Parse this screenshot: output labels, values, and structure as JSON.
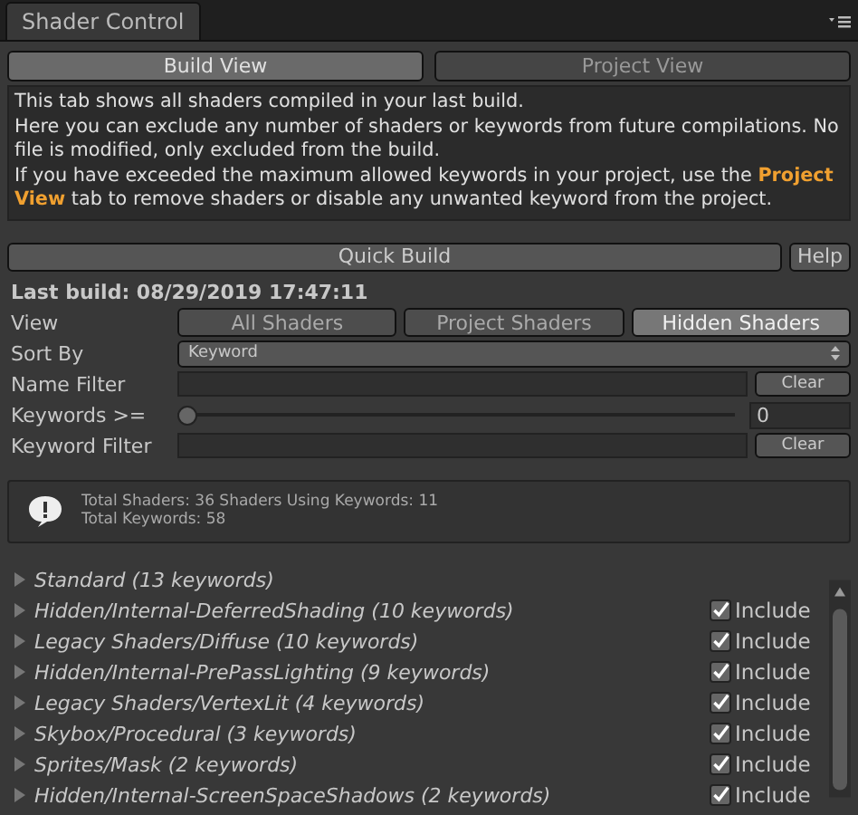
{
  "window": {
    "tab": "Shader Control"
  },
  "view_tabs": [
    {
      "label": "Build View",
      "selected": true
    },
    {
      "label": "Project View",
      "selected": false
    }
  ],
  "description": [
    "This tab shows all shaders compiled in your last build.",
    "Here you can exclude any number of shaders or keywords from future compilations. No file is modified, only excluded from the build.",
    "If you have exceeded the maximum allowed keywords in your project, use the **Project View** tab to remove shaders or disable any unwanted keyword from the project."
  ],
  "quick_build": "Quick Build",
  "help": "Help",
  "last_build": "Last build: 08/29/2019 17:47:11",
  "view": {
    "label": "View",
    "options": [
      {
        "label": "All Shaders",
        "selected": false
      },
      {
        "label": "Project Shaders",
        "selected": false
      },
      {
        "label": "Hidden Shaders",
        "selected": true
      }
    ]
  },
  "sort_by": {
    "label": "Sort By",
    "value": "Keyword"
  },
  "name_filter": {
    "label": "Name Filter",
    "clear": "Clear"
  },
  "keywords_min": {
    "label": "Keywords >=",
    "level": 0,
    "value": "0"
  },
  "keyword_filter": {
    "label": "Keyword Filter",
    "clear": "Clear"
  },
  "info": [
    "Total Shaders: 36  Shaders Using Keywords: 11",
    "Total Keywords: 58"
  ],
  "shaders": [
    {
      "name": "Standard (13 keywords)",
      "expanded": false
    },
    {
      "name": "Hidden/Internal-DeferredShading (10 keywords)",
      "expanded": false,
      "include": {
        "label": "Include",
        "checked": true
      }
    },
    {
      "name": "Legacy Shaders/Diffuse (10 keywords)",
      "expanded": false,
      "include": {
        "label": "Include",
        "checked": true
      }
    },
    {
      "name": "Hidden/Internal-PrePassLighting (9 keywords)",
      "expanded": false,
      "include": {
        "label": "Include",
        "checked": true
      }
    },
    {
      "name": "Legacy Shaders/VertexLit (4 keywords)",
      "expanded": false,
      "include": {
        "label": "Include",
        "checked": true
      }
    },
    {
      "name": "Skybox/Procedural (3 keywords)",
      "expanded": false,
      "include": {
        "label": "Include",
        "checked": true
      }
    },
    {
      "name": "Sprites/Mask (2 keywords)",
      "expanded": false,
      "include": {
        "label": "Include",
        "checked": true
      }
    },
    {
      "name": "Hidden/Internal-ScreenSpaceShadows (2 keywords)",
      "expanded": false,
      "include": {
        "label": "Include",
        "checked": true
      }
    }
  ]
}
